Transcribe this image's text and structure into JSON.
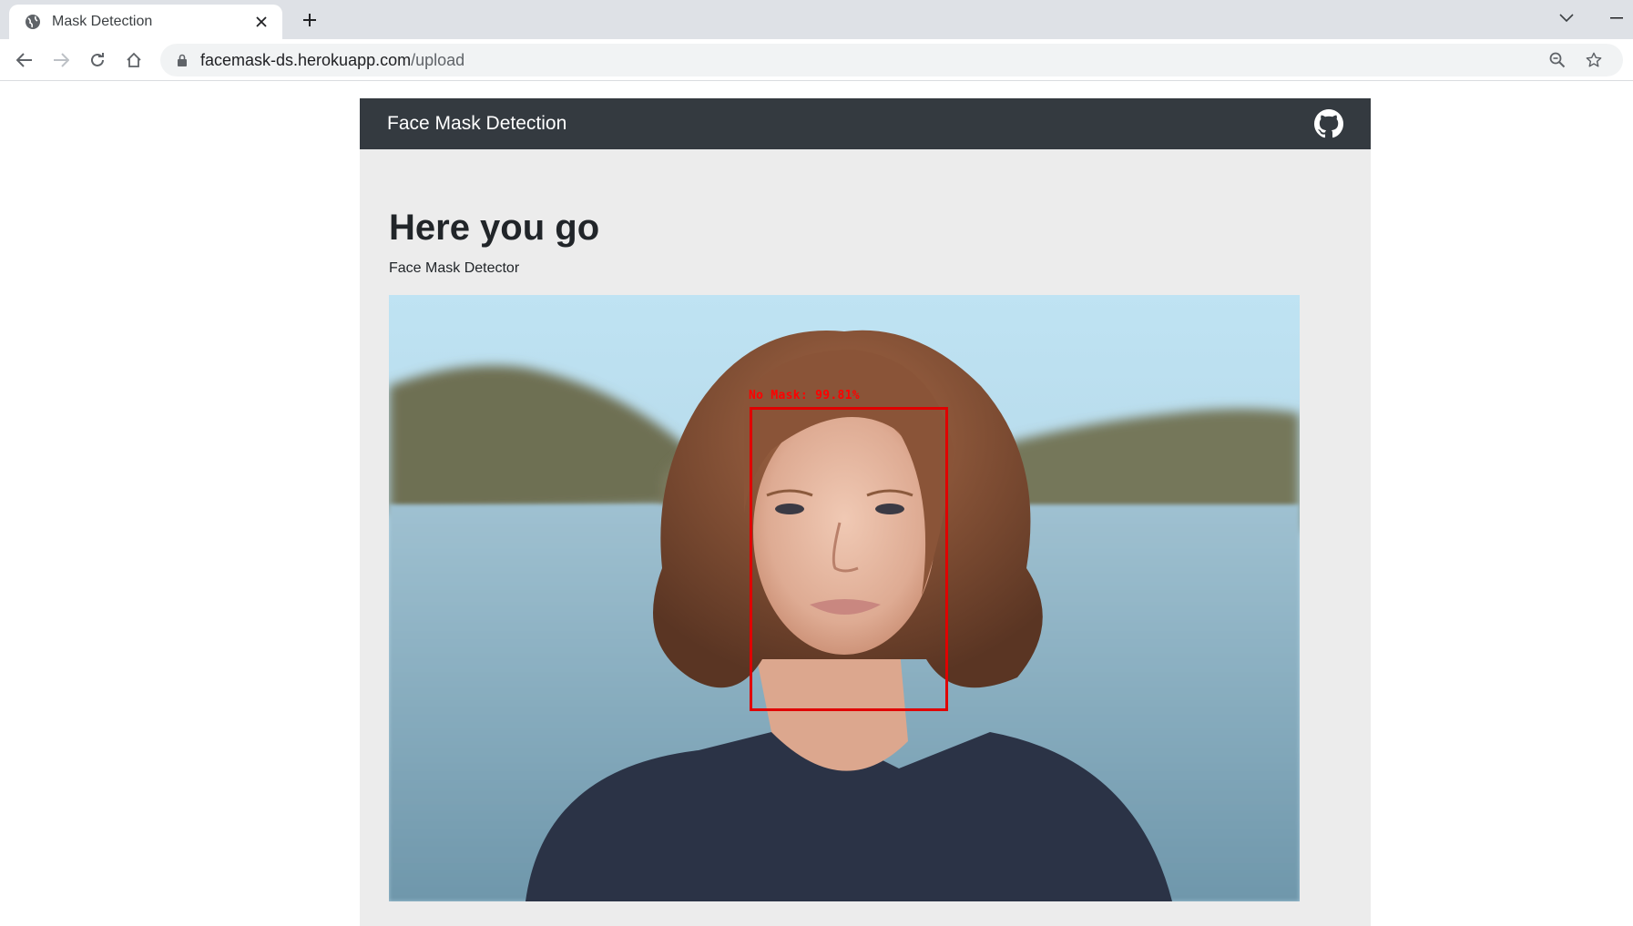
{
  "browser": {
    "tab_title": "Mask Detection",
    "url_host": "facemask-ds.herokuapp.com",
    "url_path": "/upload"
  },
  "icons": {
    "tab_favicon": "globe-icon",
    "tab_close": "close-icon",
    "new_tab": "plus-icon",
    "tab_search": "chevron-down-icon",
    "minimize": "minimize-icon",
    "back": "arrow-left-icon",
    "forward": "arrow-right-icon",
    "reload": "reload-icon",
    "home": "home-icon",
    "lock": "lock-icon",
    "zoom": "zoom-out-icon",
    "bookmark": "star-icon",
    "github": "github-icon"
  },
  "navbar": {
    "brand": "Face Mask Detection"
  },
  "main": {
    "heading": "Here you go",
    "subtitle": "Face Mask Detector",
    "detection_label": "No Mask: 99.81%"
  },
  "colors": {
    "navbar_bg": "#343a40",
    "page_bg": "#ececec",
    "detection_box": "#ff0000"
  }
}
